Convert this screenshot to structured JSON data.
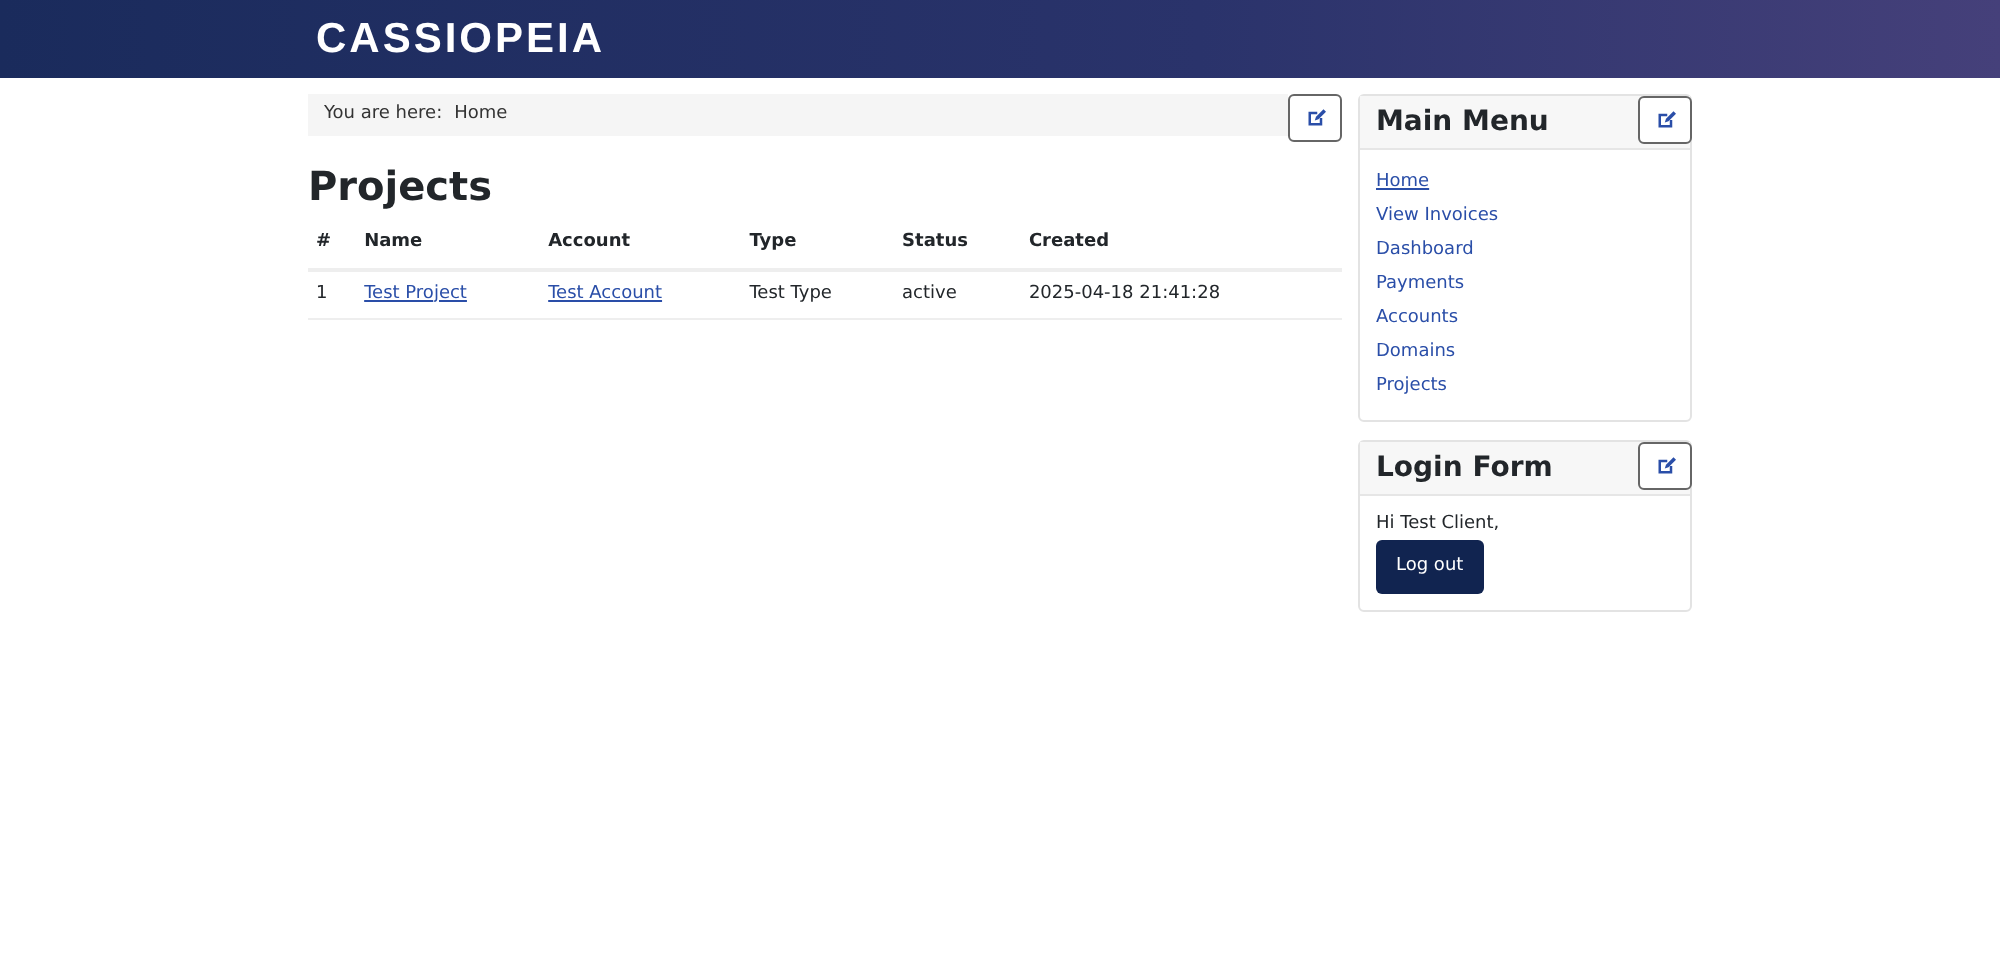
{
  "header": {
    "logo": "CASSIOPEIA"
  },
  "breadcrumb": {
    "label": "You are here:",
    "items": [
      "Home"
    ]
  },
  "page": {
    "title": "Projects"
  },
  "table": {
    "columns": [
      "#",
      "Name",
      "Account",
      "Type",
      "Status",
      "Created"
    ],
    "rows": [
      {
        "cells": [
          "1",
          "Test Project",
          "Test Account",
          "Test Type",
          "active",
          "2025-04-18 21:41:28"
        ],
        "links": [
          false,
          true,
          true,
          false,
          false,
          false
        ]
      }
    ]
  },
  "main_menu": {
    "title": "Main Menu",
    "items": [
      {
        "label": "Home",
        "selected": true
      },
      {
        "label": "View Invoices",
        "selected": false
      },
      {
        "label": "Dashboard",
        "selected": false
      },
      {
        "label": "Payments",
        "selected": false
      },
      {
        "label": "Accounts",
        "selected": false
      },
      {
        "label": "Domains",
        "selected": false
      },
      {
        "label": "Projects",
        "selected": false
      }
    ]
  },
  "login_form": {
    "title": "Login Form",
    "greeting": "Hi Test Client,",
    "button": "Log out"
  }
}
